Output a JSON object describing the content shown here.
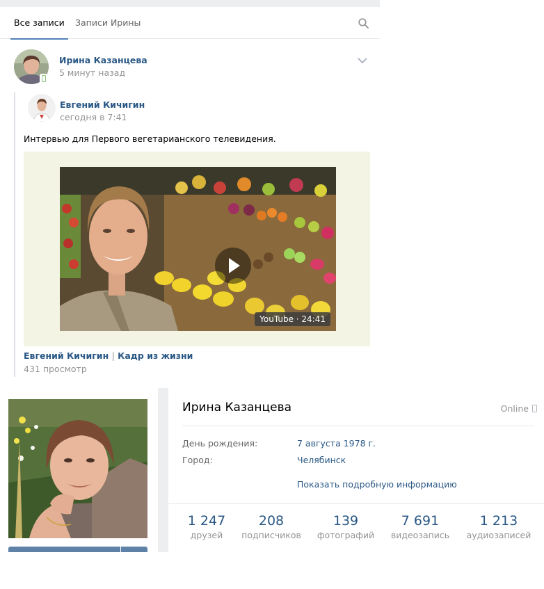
{
  "tabs": {
    "all_posts": "Все записи",
    "user_posts": "Записи Ирины"
  },
  "post": {
    "author": "Ирина Казанцева",
    "time": "5 минут назад",
    "repost": {
      "author": "Евгений Кичигин",
      "time": "сегодня в 7:41",
      "text": "Интервью для Первого вегетарианского телевидения.",
      "video": {
        "duration": "YouTube · 24:41",
        "title_author": "Евгений Кичигин",
        "title_separator": "|",
        "title_name": "Кадр из жизни",
        "views": "431 просмотр"
      }
    }
  },
  "profile": {
    "name": "Ирина Казанцева",
    "status": "Online",
    "birthday_label": "День рождения:",
    "birthday_value": "7 августа 1978 г.",
    "city_label": "Город:",
    "city_value": "Челябинск",
    "more_info": "Показать подробную информацию",
    "counters": [
      {
        "num": "1 247",
        "cap": "друзей"
      },
      {
        "num": "208",
        "cap": "подписчиков"
      },
      {
        "num": "139",
        "cap": "фотографий"
      },
      {
        "num": "7 691",
        "cap": "видеозапись"
      },
      {
        "num": "1 213",
        "cap": "аудиозаписей"
      }
    ]
  },
  "icons": {
    "search": "search-icon",
    "menu": "chevron-down-icon",
    "mobile": "mobile-phone-icon",
    "play": "play-icon"
  },
  "colors": {
    "link": "#2a5885",
    "accent": "#5181b8",
    "muted": "#939393",
    "background": "#edeef0"
  }
}
